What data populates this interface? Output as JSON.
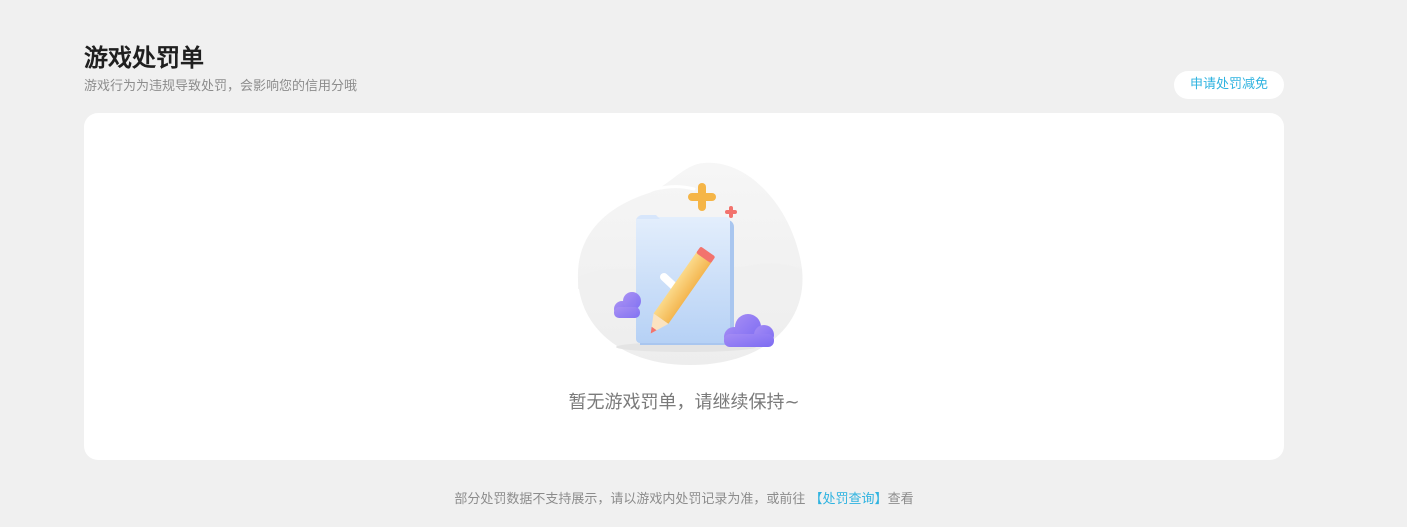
{
  "header": {
    "title": "游戏处罚单",
    "subtitle": "游戏行为为违规导致处罚，会影响您的信用分哦"
  },
  "actions": {
    "apply_reduction_label": "申请处罚减免"
  },
  "empty_state": {
    "illustration_icon": "empty-document-pencil-icon",
    "message": "暂无游戏罚单，请继续保持~"
  },
  "footer": {
    "note_prefix": "部分处罚数据不支持展示，请以游戏内处罚记录为准，或前往 ",
    "link_label": "【处罚查询】",
    "note_suffix": "查看"
  },
  "colors": {
    "background": "#f0f0f0",
    "card": "#ffffff",
    "accent": "#2fb3e0",
    "title": "#1f1f1f",
    "muted": "#8c8c8c"
  }
}
